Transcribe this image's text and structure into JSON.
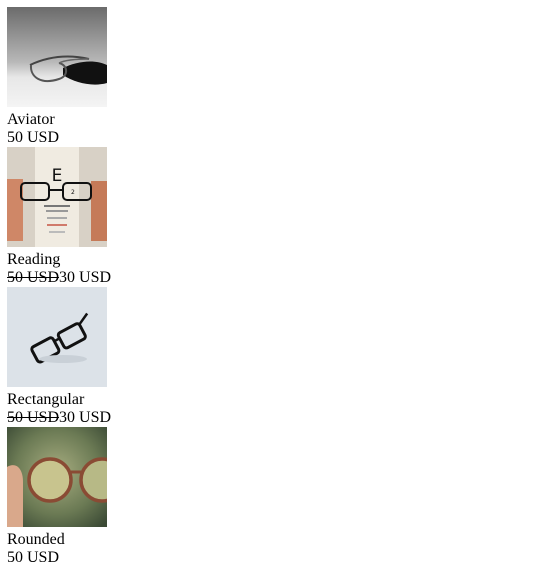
{
  "products": [
    {
      "name": "Aviator",
      "price": "50 USD",
      "original_price": "",
      "image_icon": "aviator-glasses-photo"
    },
    {
      "name": "Reading",
      "price": "30 USD",
      "original_price": "50 USD",
      "image_icon": "reading-glasses-eye-chart-photo"
    },
    {
      "name": "Rectangular",
      "price": "30 USD",
      "original_price": "50 USD",
      "image_icon": "rectangular-glasses-photo"
    },
    {
      "name": "Rounded",
      "price": "50 USD",
      "original_price": "",
      "image_icon": "rounded-glasses-photo"
    }
  ],
  "colors": {
    "text": "#000000",
    "background": "#ffffff",
    "card_gray": "#d9dfe5",
    "card_green": "#6d7a54"
  }
}
